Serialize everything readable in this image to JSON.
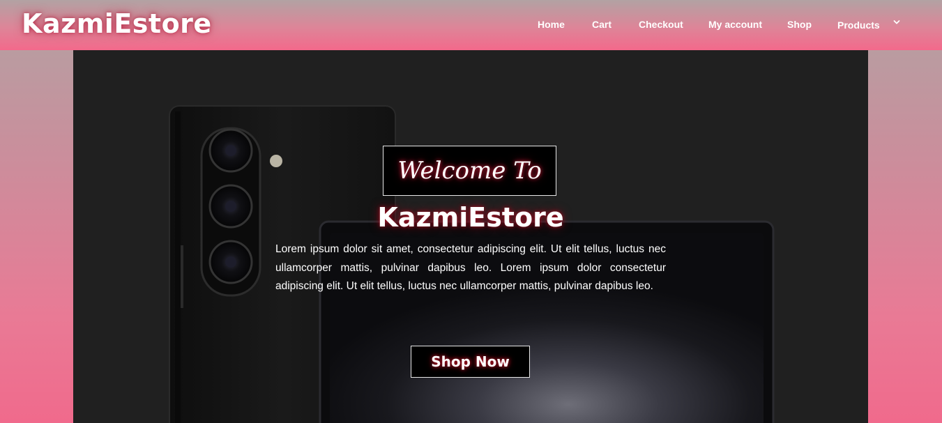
{
  "header": {
    "logo": "KazmiEstore"
  },
  "nav": {
    "items": [
      {
        "label": "Home"
      },
      {
        "label": "Cart"
      },
      {
        "label": "Checkout"
      },
      {
        "label": "My account"
      },
      {
        "label": "Shop"
      },
      {
        "label": "Products"
      }
    ],
    "dropdown_icon": "chevron-down-icon"
  },
  "hero": {
    "welcome": "Welcome To",
    "title": "KazmiEstore",
    "description": "Lorem ipsum dolor sit amet, consectetur adipiscing elit. Ut elit tellus, luctus nec ullamcorper mattis, pulvinar dapibus leo. Lorem ipsum dolor consectetur adipiscing elit. Ut elit tellus, luctus nec ullamcorper mattis, pulvinar dapibus leo.",
    "cta": "Shop Now"
  },
  "colors": {
    "header_gradient_top": "#b2a2a3",
    "header_gradient_bottom": "#f3698b",
    "hero_background": "#202020",
    "text": "#ffffff",
    "glow": "#c0142c"
  }
}
